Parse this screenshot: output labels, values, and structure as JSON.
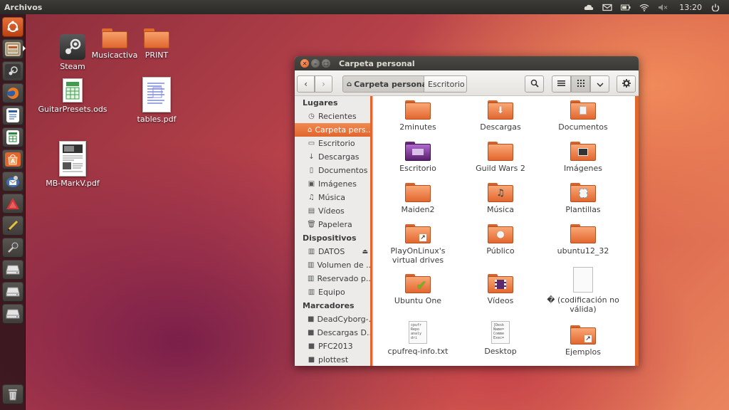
{
  "top_panel": {
    "app_title": "Archivos",
    "clock": "13:20",
    "indicators": [
      "cloud-icon",
      "mail-icon",
      "battery-icon",
      "wifi-icon",
      "volume-mute-icon",
      "power-icon"
    ]
  },
  "launcher": {
    "items": [
      {
        "name": "ubuntu-dash",
        "color": "#dd4814"
      },
      {
        "name": "files",
        "color": "#8a7d6e"
      },
      {
        "name": "steam",
        "color": "#4a4a4a"
      },
      {
        "name": "firefox",
        "color": "#e8641f"
      },
      {
        "name": "writer",
        "color": "#2a5fa8"
      },
      {
        "name": "calc",
        "color": "#2b8a3e"
      },
      {
        "name": "software-center",
        "color": "#e0662e"
      },
      {
        "name": "thunderbird",
        "color": "#3c6eb4"
      },
      {
        "name": "impress",
        "color": "#c0392b"
      },
      {
        "name": "tool",
        "color": "#7a6a3a"
      },
      {
        "name": "mic",
        "color": "#6a4a3a"
      },
      {
        "name": "drive-1",
        "color": "#cfcfcf"
      },
      {
        "name": "drive-2",
        "color": "#cfcfcf"
      },
      {
        "name": "drive-3",
        "color": "#cfcfcf"
      },
      {
        "name": "trash",
        "color": "#9a9a9a"
      }
    ]
  },
  "desktop": {
    "icons": [
      {
        "label": "Steam"
      },
      {
        "label": "Musicactiva"
      },
      {
        "label": "PRINT"
      },
      {
        "label": "GuitarPresets.ods"
      },
      {
        "label": "tables.pdf"
      },
      {
        "label": "MB-MarkV.pdf"
      }
    ]
  },
  "window": {
    "title": "Carpeta personal",
    "breadcrumb": [
      "Carpeta personal",
      "Escritorio"
    ],
    "sidebar": {
      "sections": [
        {
          "heading": "Lugares",
          "items": [
            "Recientes",
            "Carpeta pers...",
            "Escritorio",
            "Descargas",
            "Documentos",
            "Imágenes",
            "Música",
            "Vídeos",
            "Papelera"
          ]
        },
        {
          "heading": "Dispositivos",
          "items": [
            "DATOS",
            "Volumen de ...",
            "Reservado p...",
            "Equipo"
          ]
        },
        {
          "heading": "Marcadores",
          "items": [
            "DeadCyborg-...",
            "Descargas D...",
            "PFC2013",
            "plottest"
          ]
        }
      ]
    },
    "files": [
      {
        "label": "2minutes"
      },
      {
        "label": "Descargas"
      },
      {
        "label": "Documentos"
      },
      {
        "label": "Escritorio"
      },
      {
        "label": "Guild Wars 2"
      },
      {
        "label": "Imágenes"
      },
      {
        "label": "Maiden2"
      },
      {
        "label": "Música"
      },
      {
        "label": "Plantillas"
      },
      {
        "label": "PlayOnLinux's virtual drives"
      },
      {
        "label": "Público"
      },
      {
        "label": "ubuntu12_32"
      },
      {
        "label": "Ubuntu One"
      },
      {
        "label": "Vídeos"
      },
      {
        "label": "� (codificación no válida)"
      },
      {
        "label": "cpufreq-info.txt"
      },
      {
        "label": "Desktop"
      },
      {
        "label": "Ejemplos"
      }
    ],
    "doc_previews": {
      "cpufreq": "cpufr Repo analy dri",
      "desktop": "[Desk Name= Comme Exec="
    }
  }
}
